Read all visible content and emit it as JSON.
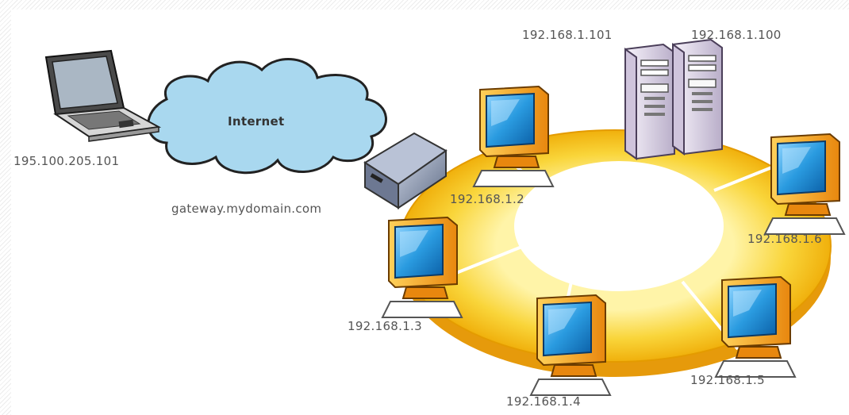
{
  "diagram": {
    "cloud_label": "Internet",
    "gateway_label": "gateway.mydomain.com",
    "laptop_label": "195.100.205.101",
    "servers": [
      {
        "label": "192.168.1.101"
      },
      {
        "label": "192.168.1.100"
      }
    ],
    "clients": [
      {
        "label": "192.168.1.2"
      },
      {
        "label": "192.168.1.3"
      },
      {
        "label": "192.168.1.4"
      },
      {
        "label": "192.168.1.5"
      },
      {
        "label": "192.168.1.6"
      }
    ]
  },
  "colors": {
    "ring_outer": "#f6c21a",
    "ring_inner": "#fde873",
    "cloud": "#a9d8ef",
    "monitor_body": "#f4a21a",
    "screen": "#1f8fd6",
    "server": "#e3dbeb"
  }
}
